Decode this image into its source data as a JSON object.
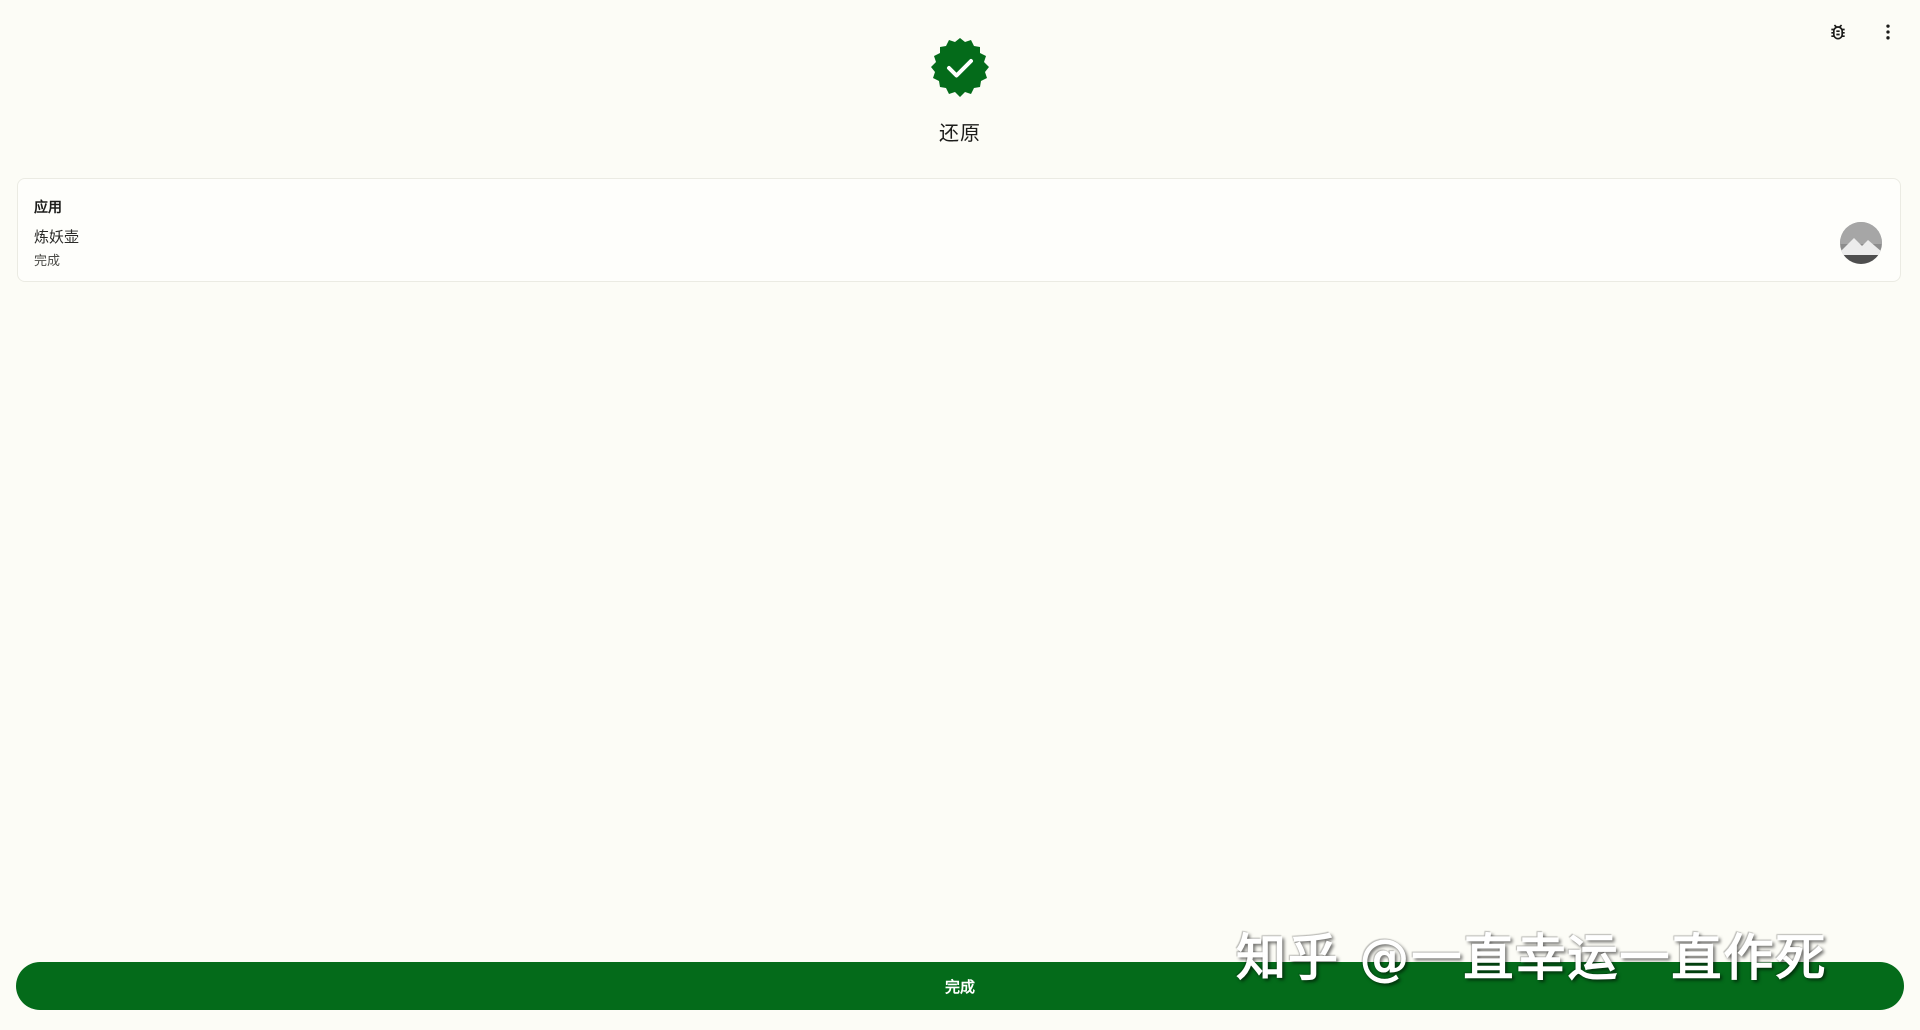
{
  "header": {
    "title": "还原",
    "status_icon": "check-badge-icon",
    "accent_color": "#046b1a",
    "actions": [
      {
        "icon": "bug-icon"
      },
      {
        "icon": "more-vert-icon"
      }
    ]
  },
  "card": {
    "heading": "应用",
    "app_name": "炼妖壶",
    "app_status": "完成",
    "avatar_icon": "app-avatar-icon"
  },
  "footer": {
    "done_label": "完成"
  },
  "watermark": {
    "text": "知乎 @一直幸运一直作死"
  }
}
